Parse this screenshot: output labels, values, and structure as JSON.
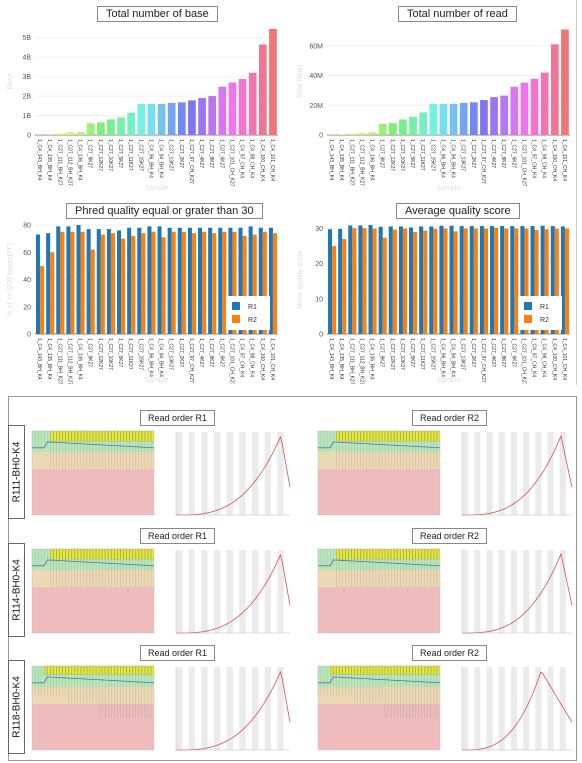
{
  "samples": [
    "1_C4_143_BH_K4",
    "1_C4_135_BH_K4",
    "1_C27_111_BH_K27",
    "1_C27_112_BH_K27",
    "1_C4_136_BH_K4",
    "1_C27_9K27",
    "1_C27_12K27",
    "1_C27_10K27",
    "1_C27_5K27",
    "1_C27_11K27",
    "1_C27_15K27",
    "1_C4_96_BH_K4",
    "1_C4_94_BH_K4",
    "1_C27_13K27",
    "1_C27_2K27",
    "1_C27_97_CH_K27",
    "1_C27_4K27",
    "1_C27_8K27",
    "1_C27_6K27",
    "1_C27_101_CH_K27",
    "1_C4_97_CH_K4",
    "1_C4_98_CH_K4",
    "1_C4_100_CH_K4",
    "1_C4_101_CH_K4"
  ],
  "chart_data": [
    {
      "type": "bar",
      "title": "Total number of base",
      "ylabel": "Base",
      "xlabel": "Sample",
      "ylim": [
        0,
        5.5
      ],
      "yticks": [
        0,
        1,
        2,
        3,
        4,
        5
      ],
      "ytick_labels": [
        "0",
        "1B",
        "2B",
        "3B",
        "4B",
        "5B"
      ],
      "values": [
        0.03,
        0.03,
        0.08,
        0.15,
        0.15,
        0.6,
        0.65,
        0.8,
        0.9,
        1.15,
        1.6,
        1.6,
        1.6,
        1.65,
        1.68,
        1.78,
        1.9,
        2.0,
        2.48,
        2.7,
        2.88,
        3.2,
        4.65,
        5.45
      ],
      "colors": "rainbow"
    },
    {
      "type": "bar",
      "title": "Total number of read",
      "ylabel": "Total Read",
      "xlabel": "Sample",
      "ylim": [
        0,
        72
      ],
      "yticks": [
        0,
        20,
        40,
        60
      ],
      "ytick_labels": [
        "0",
        "20M",
        "40M",
        "60M"
      ],
      "values": [
        0.3,
        0.3,
        0.8,
        1.5,
        1.8,
        7.5,
        8,
        10.5,
        12.3,
        15.2,
        21,
        21,
        21,
        21.6,
        22,
        23.5,
        25.5,
        26.5,
        32.5,
        35.2,
        37.8,
        42,
        61,
        71
      ],
      "colors": "rainbow"
    },
    {
      "type": "bar",
      "title": "Phred quality equal or grater than 30",
      "ylabel": "% of >= Q30 bases(PF)",
      "xlabel": "Sample",
      "ylim": [
        0,
        80
      ],
      "yticks": [
        0,
        20,
        40,
        60,
        80
      ],
      "ytick_labels": [
        "0",
        "20",
        "40",
        "60",
        "80"
      ],
      "legend": "bottom-right",
      "series": [
        {
          "name": "R1",
          "color": "#1f77b4",
          "values": [
            73,
            74,
            79,
            79,
            80,
            77,
            77,
            77,
            76,
            78,
            78,
            79,
            79,
            78,
            78,
            78,
            78,
            78,
            78,
            78,
            78,
            79,
            78,
            78
          ]
        },
        {
          "name": "R2",
          "color": "#ff7f0e",
          "values": [
            50,
            60,
            75,
            75,
            75,
            62,
            73,
            74,
            70,
            72,
            74,
            75,
            71,
            75,
            75,
            74,
            75,
            74,
            75,
            75,
            72,
            73,
            75,
            74
          ]
        }
      ]
    },
    {
      "type": "bar",
      "title": "Average quality score",
      "ylabel": "Mean quality score",
      "xlabel": "Sample",
      "ylim": [
        0,
        31
      ],
      "yticks": [
        0,
        10,
        20,
        30
      ],
      "ytick_labels": [
        "0",
        "10",
        "20",
        "30"
      ],
      "legend": "bottom-right",
      "series": [
        {
          "name": "R1",
          "color": "#1f77b4",
          "values": [
            29.8,
            29.9,
            30.9,
            30.9,
            31,
            30.5,
            30.6,
            30.6,
            30.3,
            30.6,
            30.6,
            30.8,
            30.8,
            30.7,
            30.7,
            30.7,
            30.7,
            30.7,
            30.7,
            30.7,
            30.7,
            30.8,
            30.7,
            30.6
          ]
        },
        {
          "name": "R2",
          "color": "#ff7f0e",
          "values": [
            25,
            27,
            30.1,
            30.1,
            30,
            27.4,
            29.7,
            30,
            29,
            29.4,
            29.9,
            30,
            29.2,
            30,
            30,
            30,
            30.2,
            30,
            30,
            30,
            29.6,
            29.8,
            30,
            30
          ]
        }
      ]
    }
  ],
  "qc": {
    "rows": [
      {
        "label": "R111-BH0-K4"
      },
      {
        "label": "R114-BH0-K4"
      },
      {
        "label": "R118-BH0-K4"
      }
    ],
    "r1_title": "Read order R1",
    "r2_title": "Read order R2"
  }
}
